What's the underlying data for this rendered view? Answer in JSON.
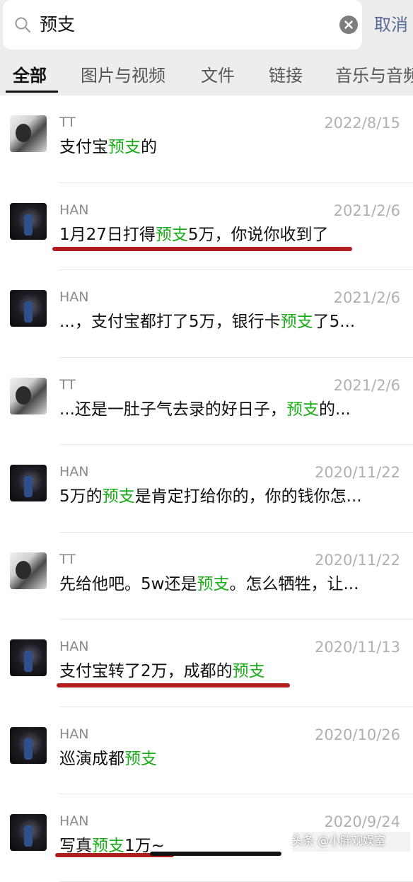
{
  "search": {
    "query": "预支",
    "cancel_label": "取消"
  },
  "tabs": [
    "全部",
    "图片与视频",
    "文件",
    "链接",
    "音乐与音频"
  ],
  "results": [
    {
      "sender": "TT",
      "date": "2022/8/15",
      "avatar": "tt",
      "parts": [
        {
          "t": "支付宝",
          "h": false
        },
        {
          "t": "预支",
          "h": true
        },
        {
          "t": "的",
          "h": false
        }
      ]
    },
    {
      "sender": "HAN",
      "date": "2021/2/6",
      "avatar": "han",
      "parts": [
        {
          "t": "1月27日打得",
          "h": false
        },
        {
          "t": "预支",
          "h": true
        },
        {
          "t": "5万，你说你收到了",
          "h": false
        }
      ]
    },
    {
      "sender": "HAN",
      "date": "2021/2/6",
      "avatar": "han",
      "parts": [
        {
          "t": "...，支付宝都打了5万，银行卡",
          "h": false
        },
        {
          "t": "预支",
          "h": true
        },
        {
          "t": "了5...",
          "h": false
        }
      ]
    },
    {
      "sender": "TT",
      "date": "2021/2/6",
      "avatar": "tt",
      "parts": [
        {
          "t": "...还是一肚子气去录的好日子，",
          "h": false
        },
        {
          "t": "预支",
          "h": true
        },
        {
          "t": "的...",
          "h": false
        }
      ]
    },
    {
      "sender": "HAN",
      "date": "2020/11/22",
      "avatar": "han",
      "parts": [
        {
          "t": "5万的",
          "h": false
        },
        {
          "t": "预支",
          "h": true
        },
        {
          "t": "是肯定打给你的，你的钱你怎...",
          "h": false
        }
      ]
    },
    {
      "sender": "TT",
      "date": "2020/11/22",
      "avatar": "tt",
      "parts": [
        {
          "t": "先给他吧。5w还是",
          "h": false
        },
        {
          "t": "预支",
          "h": true
        },
        {
          "t": "。怎么牺牲，让...",
          "h": false
        }
      ]
    },
    {
      "sender": "HAN",
      "date": "2020/11/13",
      "avatar": "han",
      "parts": [
        {
          "t": "支付宝转了2万，成都的",
          "h": false
        },
        {
          "t": "预支",
          "h": true
        }
      ]
    },
    {
      "sender": "HAN",
      "date": "2020/10/26",
      "avatar": "han",
      "parts": [
        {
          "t": "巡演成都",
          "h": false
        },
        {
          "t": "预支",
          "h": true
        }
      ]
    },
    {
      "sender": "HAN",
      "date": "2020/9/24",
      "avatar": "han",
      "parts": [
        {
          "t": "写真",
          "h": false
        },
        {
          "t": "预支",
          "h": true
        },
        {
          "t": "1万~",
          "h": false
        }
      ]
    }
  ],
  "watermark": "头条 @小胖观娱室",
  "colors": {
    "highlight": "#1aad19",
    "cancel": "#576b95",
    "annotation_red": "#b51e1e"
  },
  "icons": [
    "search-icon",
    "clear-icon"
  ]
}
